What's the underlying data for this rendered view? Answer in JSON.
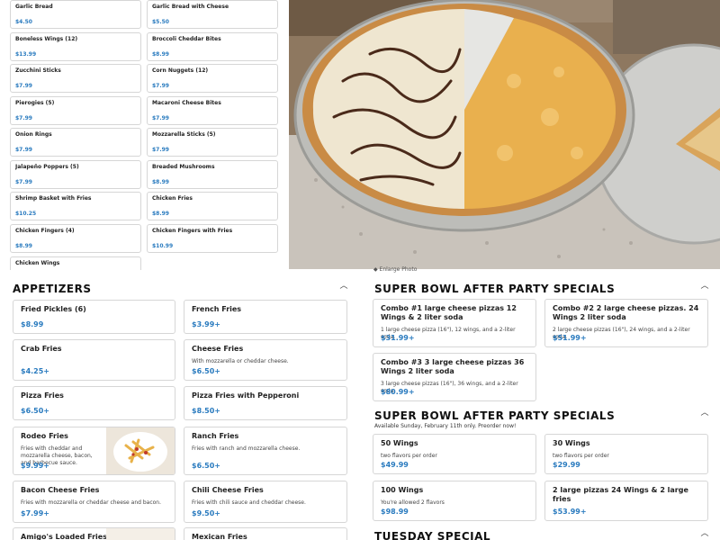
{
  "top_menu": {
    "items": [
      {
        "name": "Garlic Bread",
        "price": "$4.50"
      },
      {
        "name": "Garlic Bread with Cheese",
        "price": "$5.50"
      },
      {
        "name": "Boneless Wings (12)",
        "price": "$13.99"
      },
      {
        "name": "Broccoli Cheddar Bites",
        "price": "$8.99"
      },
      {
        "name": "Zucchini Sticks",
        "price": "$7.99"
      },
      {
        "name": "Corn Nuggets (12)",
        "price": "$7.99"
      },
      {
        "name": "Pierogies (5)",
        "price": "$7.99"
      },
      {
        "name": "Macaroni Cheese Bites",
        "price": "$7.99"
      },
      {
        "name": "Onion Rings",
        "price": "$7.99"
      },
      {
        "name": "Mozzarella Sticks (5)",
        "price": "$7.99"
      },
      {
        "name": "Jalapeño Poppers (5)",
        "price": "$7.99"
      },
      {
        "name": "Breaded Mushrooms",
        "price": "$8.99"
      },
      {
        "name": "Shrimp Basket with Fries",
        "price": "$10.25"
      },
      {
        "name": "Chicken Fries",
        "price": "$8.99"
      },
      {
        "name": "Chicken Fingers (4)",
        "price": "$8.99"
      },
      {
        "name": "Chicken Fingers with Fries",
        "price": "$10.99"
      },
      {
        "name": "Chicken Wings",
        "price": ""
      }
    ]
  },
  "photo": {
    "label": "Pizza photo",
    "caption": "Enlarge Photo"
  },
  "appetizers": {
    "title": "APPETIZERS",
    "items": [
      {
        "name": "Fried Pickles (6)",
        "desc": "",
        "price": "$8.99"
      },
      {
        "name": "French Fries",
        "desc": "",
        "price": "$3.99+"
      },
      {
        "name": "Crab Fries",
        "desc": "",
        "price": "$4.25+"
      },
      {
        "name": "Cheese Fries",
        "desc": "With mozzarella or cheddar cheese.",
        "price": "$6.50+"
      },
      {
        "name": "Pizza Fries",
        "desc": "",
        "price": "$6.50+"
      },
      {
        "name": "Pizza Fries with Pepperoni",
        "desc": "",
        "price": "$8.50+"
      },
      {
        "name": "Rodeo Fries",
        "desc": "Fries with cheddar and mozzarella cheese, bacon, and barbecue sauce.",
        "price": "$9.99+"
      },
      {
        "name": "Ranch Fries",
        "desc": "Fries with ranch and mozzarella cheese.",
        "price": "$6.50+"
      },
      {
        "name": "Bacon Cheese Fries",
        "desc": "Fries with mozzarella or cheddar cheese and bacon.",
        "price": "$7.99+"
      },
      {
        "name": "Chili Cheese Fries",
        "desc": "Fries with chili sauce and cheddar cheese.",
        "price": "$9.50+"
      },
      {
        "name": "Amigo's Loaded Fries",
        "desc": "",
        "price": ""
      },
      {
        "name": "Mexican Fries",
        "desc": "",
        "price": ""
      }
    ]
  },
  "super_bowl_1": {
    "title": "SUPER BOWL AFTER PARTY SPECIALS",
    "items": [
      {
        "name": "Combo #1 large cheese pizzas 12 Wings & 2 liter soda",
        "desc": "1 large cheese pizza (16\"), 12 wings, and a 2-liter soda.",
        "price": "$31.99+"
      },
      {
        "name": "Combo #2 2 large cheese pizzas. 24 Wings 2 liter soda",
        "desc": "2 large cheese pizzas (16\"), 24 wings, and a 2-liter soda.",
        "price": "$51.99+"
      },
      {
        "name": "Combo #3 3 large cheese pizzas 36 Wings 2 liter soda",
        "desc": "3 large cheese pizzas (16\"), 36 wings, and a 2-liter soda.",
        "price": "$80.99+"
      }
    ]
  },
  "super_bowl_2": {
    "title": "SUPER BOWL AFTER PARTY SPECIALS",
    "subtitle": "Available Sunday, February 11th only. Preorder now!",
    "items": [
      {
        "name": "50 Wings",
        "desc": "two flavors per order",
        "price": "$49.99"
      },
      {
        "name": "30 Wings",
        "desc": "two flavors per order",
        "price": "$29.99"
      },
      {
        "name": "100 Wings",
        "desc": "You're allowed 2 flavors",
        "price": "$98.99"
      },
      {
        "name": "2 large pizzas 24 Wings & 2 large fries",
        "desc": "",
        "price": "$53.99+"
      }
    ]
  },
  "tuesday": {
    "title": "TUESDAY SPECIAL"
  },
  "colors": {
    "price": "#2a7bbf",
    "border": "#d6d6d6"
  },
  "icons": {
    "collapse": "chevron-up-icon"
  }
}
